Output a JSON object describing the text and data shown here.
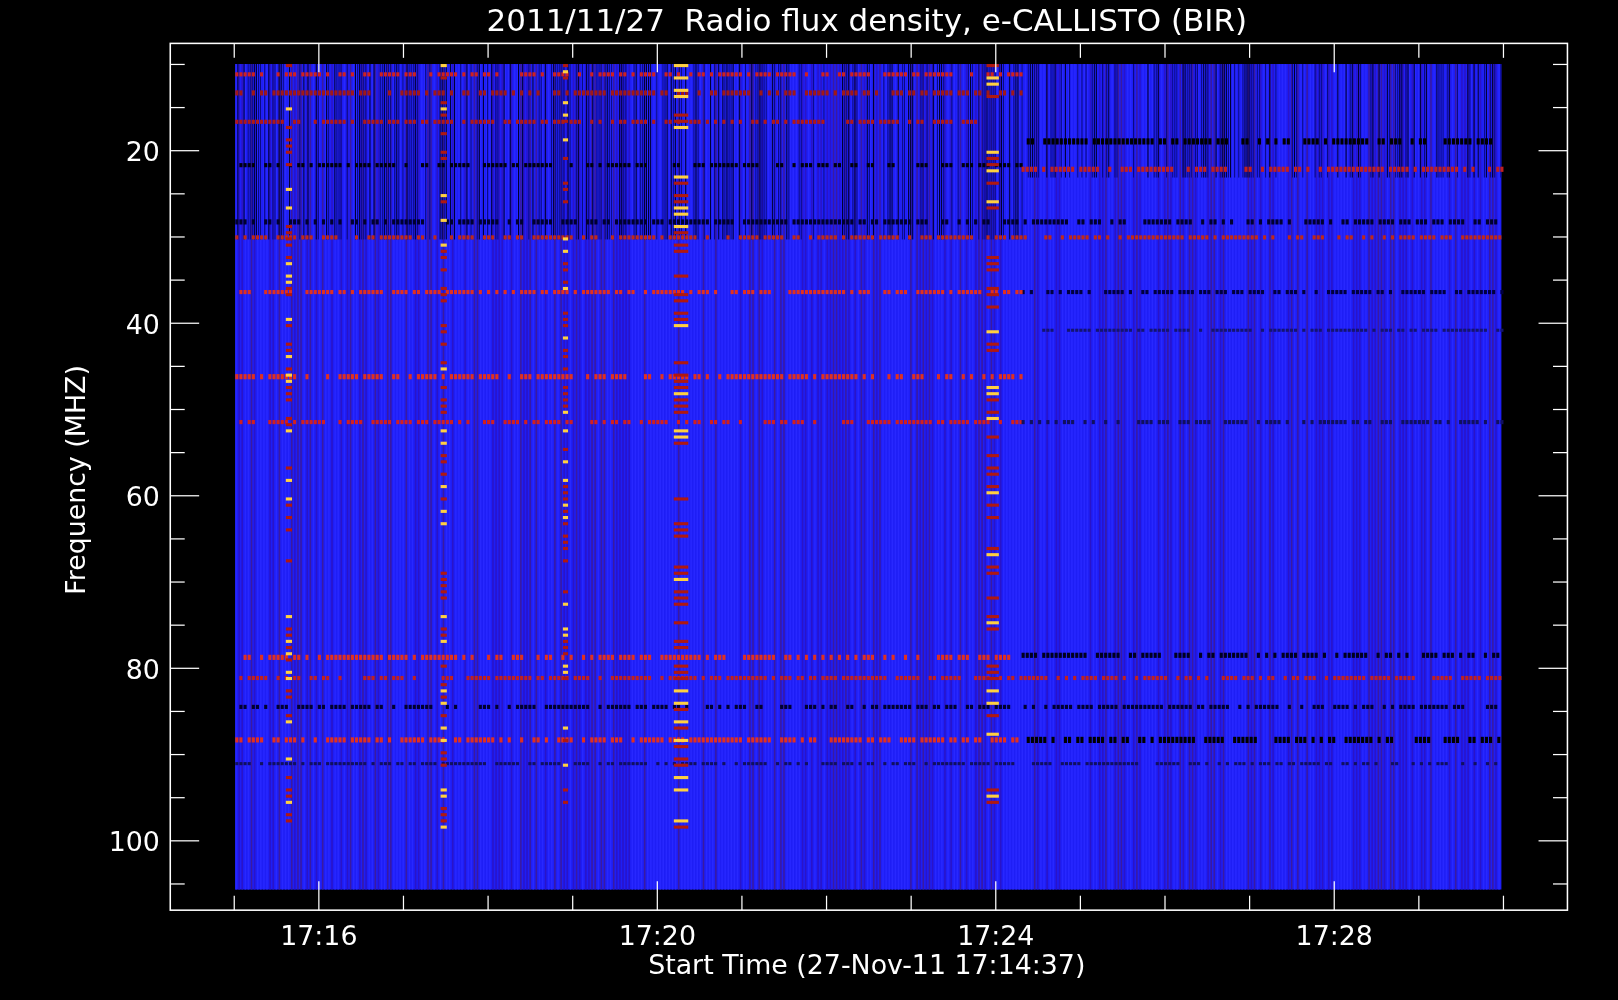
{
  "title": "2011/11/27  Radio flux density, e-CALLISTO (BIR)",
  "y_axis": {
    "label": "Frequency (MHZ)",
    "ticks": [
      "20",
      "40",
      "60",
      "80",
      "100"
    ]
  },
  "x_axis": {
    "label": "Start Time (27-Nov-11 17:14:37)",
    "ticks": [
      "17:16",
      "17:20",
      "17:24",
      "17:28"
    ]
  }
}
